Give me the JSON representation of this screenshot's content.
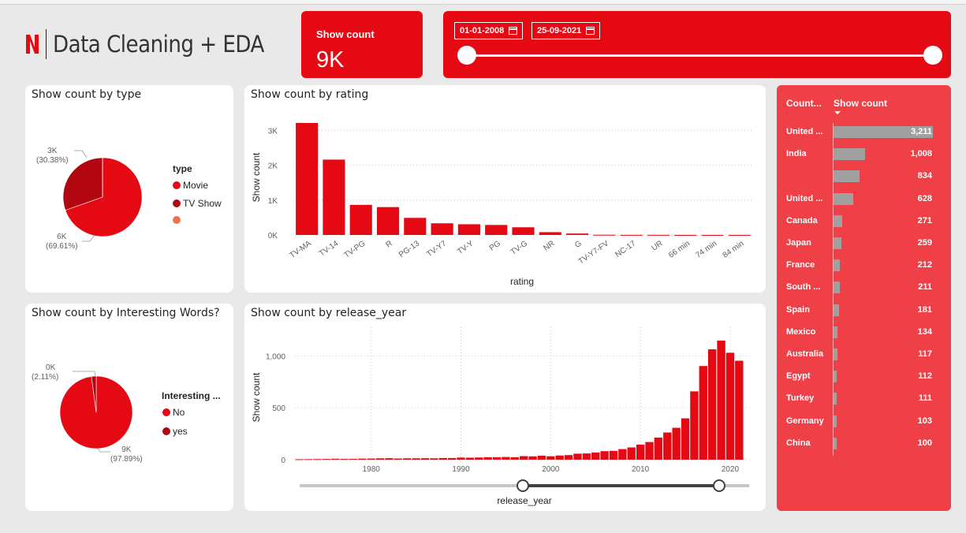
{
  "header": {
    "title": "Data Cleaning + EDA",
    "logo": "N"
  },
  "kpi": {
    "label": "Show count",
    "value": "9K"
  },
  "date_filter": {
    "start": "01-01-2008",
    "end": "25-09-2021",
    "icon": "calendar-icon"
  },
  "type_chart": {
    "title": "Show count by type",
    "legend_title": "type",
    "slices": [
      {
        "name": "Movie",
        "value_label": "6K",
        "pct_label": "(69.61%)",
        "pct": 69.61,
        "color": "#e50914"
      },
      {
        "name": "TV Show",
        "value_label": "3K",
        "pct_label": "(30.38%)",
        "pct": 30.38,
        "color": "#b20710"
      },
      {
        "name": "",
        "value_label": "",
        "pct_label": "",
        "pct": 0.01,
        "color": "#e97451"
      }
    ]
  },
  "words_chart": {
    "title": "Show count by Interesting Words?",
    "legend_title": "Interesting ...",
    "slices": [
      {
        "name": "No",
        "value_label": "9K",
        "pct_label": "(97.89%)",
        "pct": 97.89,
        "color": "#e50914"
      },
      {
        "name": "yes",
        "value_label": "0K",
        "pct_label": "(2.11%)",
        "pct": 2.11,
        "color": "#b20710"
      }
    ]
  },
  "chart_data": [
    {
      "type": "bar",
      "title": "Show count by rating",
      "xlabel": "rating",
      "ylabel": "Show count",
      "categories": [
        "TV-MA",
        "TV-14",
        "TV-PG",
        "R",
        "PG-13",
        "TV-Y7",
        "TV-Y",
        "PG",
        "TV-G",
        "NR",
        "G",
        "TV-Y7-FV",
        "NC-17",
        "UR",
        "66 min",
        "74 min",
        "84 min"
      ],
      "values": [
        3211,
        2160,
        863,
        799,
        490,
        334,
        307,
        287,
        220,
        80,
        41,
        6,
        3,
        3,
        1,
        1,
        1
      ],
      "ylim": [
        0,
        3300
      ],
      "yticks": [
        "0K",
        "1K",
        "2K",
        "3K"
      ],
      "color": "#e50914"
    },
    {
      "type": "bar",
      "title": "Show count by release_year",
      "xlabel": "release_year",
      "ylabel": "Show count",
      "x": [
        1972,
        1973,
        1974,
        1975,
        1976,
        1977,
        1978,
        1979,
        1980,
        1981,
        1982,
        1983,
        1984,
        1985,
        1986,
        1987,
        1988,
        1989,
        1990,
        1991,
        1992,
        1993,
        1994,
        1995,
        1996,
        1997,
        1998,
        1999,
        2000,
        2001,
        2002,
        2003,
        2004,
        2005,
        2006,
        2007,
        2008,
        2009,
        2010,
        2011,
        2012,
        2013,
        2014,
        2015,
        2016,
        2017,
        2018,
        2019,
        2020,
        2021
      ],
      "values": [
        4,
        5,
        6,
        7,
        9,
        7,
        8,
        10,
        11,
        13,
        14,
        11,
        13,
        13,
        14,
        13,
        16,
        16,
        20,
        19,
        21,
        24,
        24,
        26,
        24,
        34,
        32,
        38,
        33,
        40,
        44,
        58,
        60,
        69,
        82,
        85,
        102,
        118,
        145,
        170,
        213,
        262,
        307,
        398,
        658,
        902,
        1063,
        1147,
        1030,
        953
      ],
      "xticks": [
        "1980",
        "1990",
        "2000",
        "2010",
        "2020"
      ],
      "yticks": [
        "0",
        "500",
        "1,000"
      ],
      "ylim": [
        0,
        1200
      ],
      "color": "#e50914"
    },
    {
      "type": "bar",
      "title": "",
      "columns": [
        "Count...",
        "Show count"
      ],
      "categories": [
        "United ...",
        "India",
        "",
        "United ...",
        "Canada",
        "Japan",
        "France",
        "South ...",
        "Spain",
        "Mexico",
        "Australia",
        "Egypt",
        "Turkey",
        "Germany",
        "China"
      ],
      "values": [
        3211,
        1008,
        834,
        628,
        271,
        259,
        212,
        211,
        181,
        134,
        117,
        112,
        111,
        103,
        100
      ],
      "value_labels": [
        "3,211",
        "1,008",
        "834",
        "628",
        "271",
        "259",
        "212",
        "211",
        "181",
        "134",
        "117",
        "112",
        "111",
        "103",
        "100"
      ],
      "color": "#a0a0a0"
    }
  ]
}
